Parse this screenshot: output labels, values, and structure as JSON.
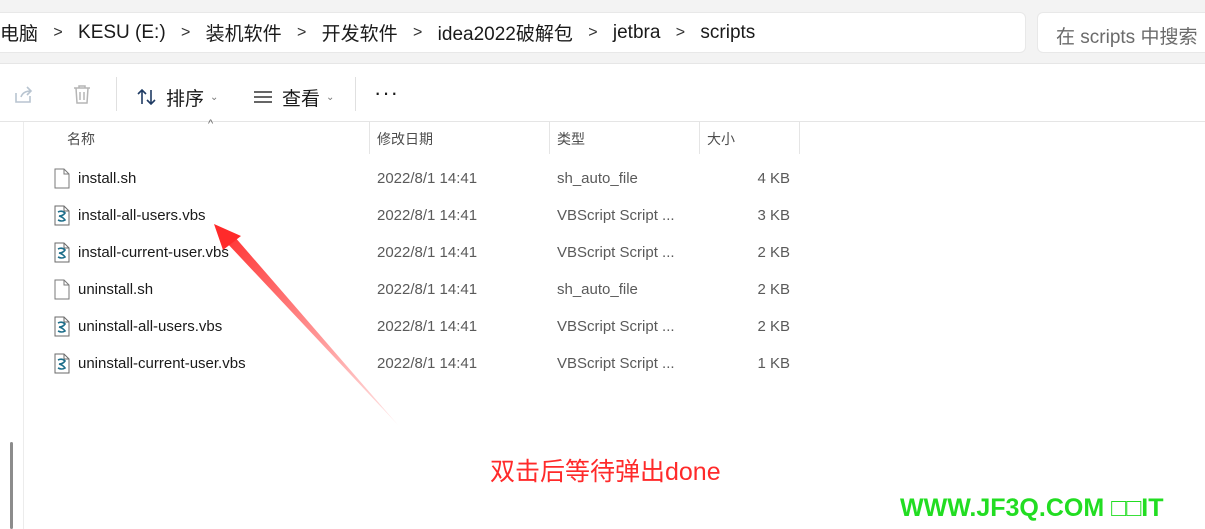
{
  "address_bar": {
    "breadcrumbs": [
      "电脑",
      "KESU (E:)",
      "装机软件",
      "开发软件",
      "idea2022破解包",
      "jetbra",
      "scripts"
    ],
    "separator": ">"
  },
  "search": {
    "placeholder": "在 scripts 中搜索"
  },
  "toolbar": {
    "share_icon": "share-icon",
    "delete_icon": "trash-icon",
    "sort_label": "排序",
    "view_label": "查看",
    "more_label": "···"
  },
  "columns": {
    "name": "名称",
    "modified": "修改日期",
    "type": "类型",
    "size": "大小"
  },
  "files": [
    {
      "name": "install.sh",
      "modified": "2022/8/1 14:41",
      "type": "sh_auto_file",
      "size": "4 KB",
      "icon": "blank-file-icon"
    },
    {
      "name": "install-all-users.vbs",
      "modified": "2022/8/1 14:41",
      "type": "VBScript Script ...",
      "size": "3 KB",
      "icon": "vbscript-file-icon"
    },
    {
      "name": "install-current-user.vbs",
      "modified": "2022/8/1 14:41",
      "type": "VBScript Script ...",
      "size": "2 KB",
      "icon": "vbscript-file-icon"
    },
    {
      "name": "uninstall.sh",
      "modified": "2022/8/1 14:41",
      "type": "sh_auto_file",
      "size": "2 KB",
      "icon": "blank-file-icon"
    },
    {
      "name": "uninstall-all-users.vbs",
      "modified": "2022/8/1 14:41",
      "type": "VBScript Script ...",
      "size": "2 KB",
      "icon": "vbscript-file-icon"
    },
    {
      "name": "uninstall-current-user.vbs",
      "modified": "2022/8/1 14:41",
      "type": "VBScript Script ...",
      "size": "1 KB",
      "icon": "vbscript-file-icon"
    }
  ],
  "annotation": {
    "text": "双击后等待弹出done",
    "color": "#ff2a2a"
  },
  "watermark": {
    "text": "WWW.JF3Q.COM □□IT",
    "color": "#22dd22"
  }
}
